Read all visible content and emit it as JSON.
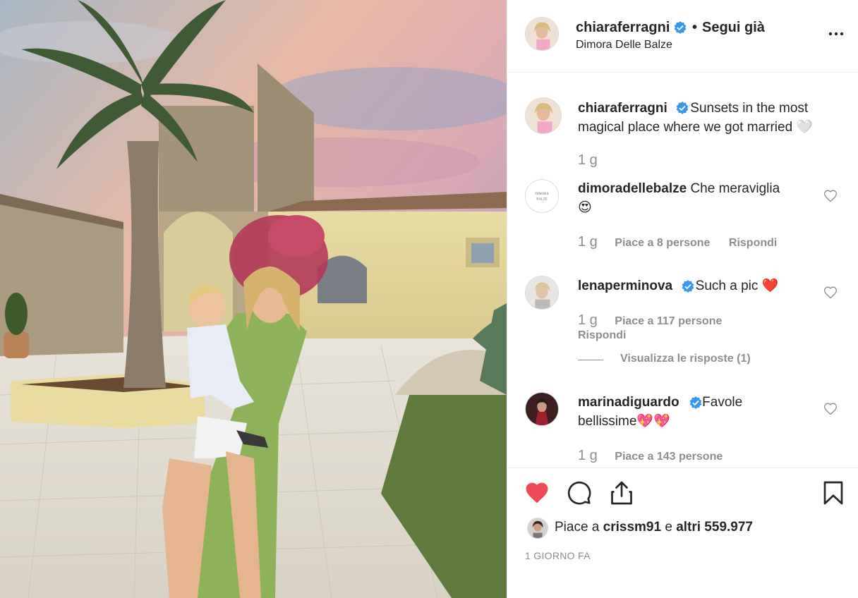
{
  "post": {
    "username": "chiaraferragni",
    "follow_dot": "•",
    "follow_status": "Segui già",
    "location": "Dimora Delle Balze",
    "more_icon": "more-horizontal-icon"
  },
  "caption": {
    "username": "chiaraferragni",
    "text_line1": "Sunsets in the most",
    "text_line2": "magical place where we got married 🤍",
    "age": "1 g"
  },
  "comments": [
    {
      "username": "dimoradellebalze",
      "avatar_text": "DIMORA BALZE",
      "text": "Che meraviglia",
      "emoji": "😍",
      "age": "1 g",
      "likes": "Piace a 8 persone",
      "reply": "Rispondi"
    },
    {
      "username": "lenaperminova",
      "text": "Such a pic",
      "emoji": "❤️",
      "age": "1 g",
      "likes": "Piace a 117 persone",
      "reply": "Rispondi",
      "view_replies": "Visualizza le risposte (1)"
    },
    {
      "username": "marinadiguardo",
      "text": "Favole",
      "text_line2": "bellissime",
      "emoji": "💖💖",
      "age": "1 g",
      "likes": "Piace a 143 persone"
    }
  ],
  "actions": {
    "liked_by_prefix": "Piace a ",
    "liked_by_user": "crissm91",
    "liked_by_mid": " e ",
    "liked_by_others": "altri 559.977",
    "time_ago": "1 GIORNO FA"
  },
  "colors": {
    "like_red": "#ed4956",
    "verified_blue": "#3897f0",
    "muted": "#8e8e8e"
  }
}
